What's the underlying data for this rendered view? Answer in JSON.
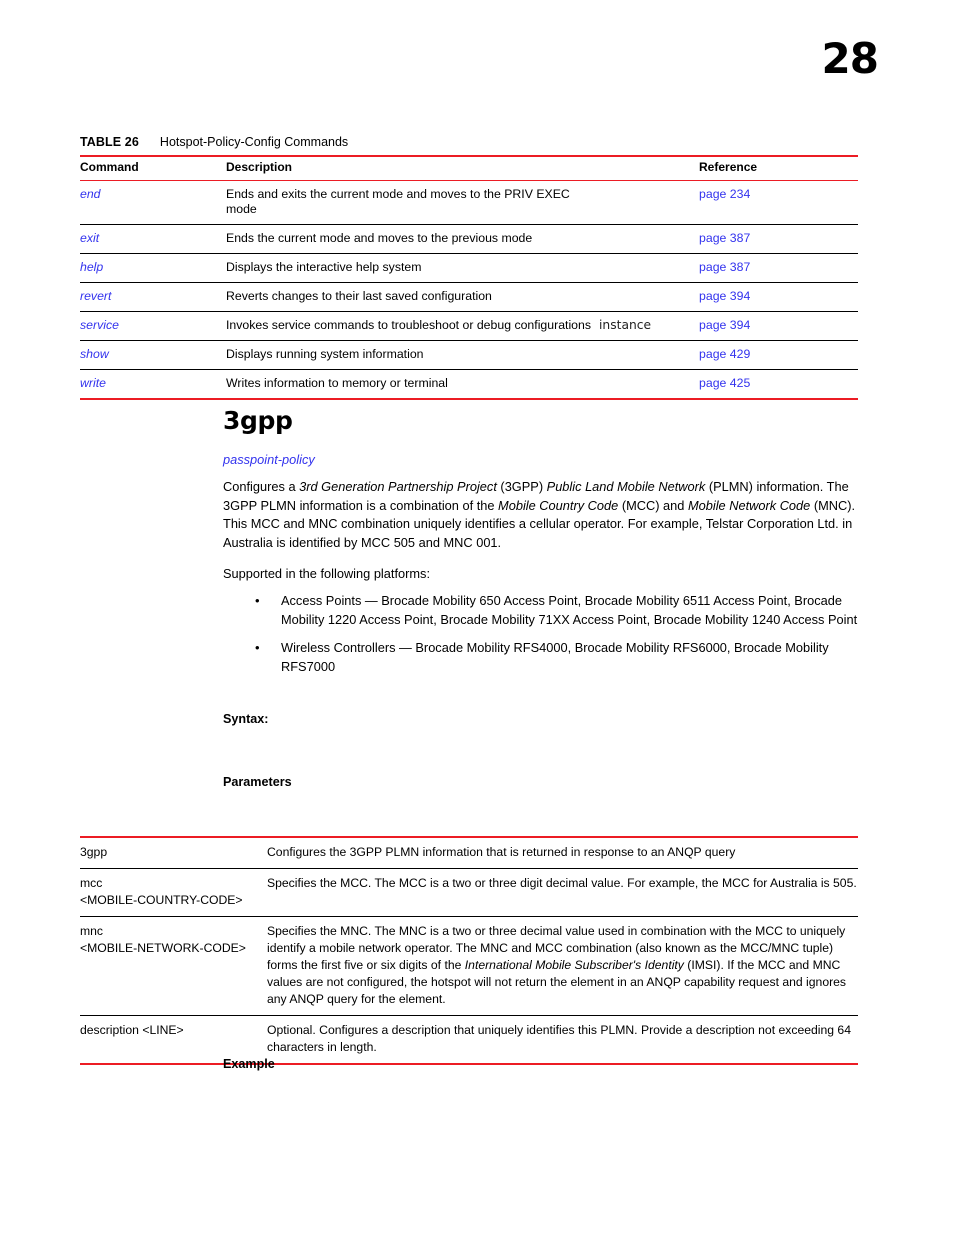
{
  "page": {
    "number": "28"
  },
  "table26": {
    "caption_label": "TABLE 26",
    "caption_text": "Hotspot-Policy-Config Commands",
    "headers": {
      "command": "Command",
      "description": "Description",
      "reference": "Reference"
    },
    "rows": [
      {
        "command": "end",
        "description": "Ends and exits the current mode and moves to the PRIV EXEC mode",
        "extra": "",
        "reference": "page 234"
      },
      {
        "command": "exit",
        "description": "Ends the current mode and moves to the previous mode",
        "extra": "",
        "reference": "page 387"
      },
      {
        "command": "help",
        "description": "Displays the interactive help system",
        "extra": "",
        "reference": "page 387"
      },
      {
        "command": "revert",
        "description": "Reverts changes to their last saved configuration",
        "extra": "",
        "reference": "page 394"
      },
      {
        "command": "service",
        "description": "Invokes service commands to troubleshoot or debug configurations",
        "extra": "instance",
        "reference": "page 394"
      },
      {
        "command": "show",
        "description": "Displays running system information",
        "extra": "",
        "reference": "page 429"
      },
      {
        "command": "write",
        "description": "Writes information to memory or terminal",
        "extra": "",
        "reference": "page 425"
      }
    ]
  },
  "section": {
    "title": "3gpp",
    "mode_link": "passpoint-policy",
    "supported_line": "Supported in the following platforms:",
    "bullets": [
      "Access Points — Brocade Mobility 650 Access Point, Brocade Mobility 6511 Access Point, Brocade Mobility 1220 Access Point, Brocade Mobility 71XX Access Point, Brocade Mobility 1240 Access Point",
      "Wireless Controllers — Brocade Mobility RFS4000, Brocade Mobility RFS6000, Brocade Mobility RFS7000"
    ],
    "bullet_glyph": "•",
    "syntax_head": "Syntax:",
    "parameters_head": "Parameters",
    "example_head": "Example"
  },
  "parameters": {
    "rows": [
      {
        "name_line1": "3gpp",
        "name_line2": "",
        "description": "Configures the 3GPP PLMN information that is returned in response to an ANQP query"
      },
      {
        "name_line1": "mcc",
        "name_line2": "<MOBILE-COUNTRY-CODE>",
        "description": "Specifies the MCC. The MCC is a two or three digit decimal value. For example, the MCC for Australia is 505."
      },
      {
        "name_line1": "mnc",
        "name_line2": "<MOBILE-NETWORK-CODE>",
        "description": "Specifies the MNC. The MNC is a two or three decimal value used in combination with the MCC to uniquely identify a mobile network operator. The MNC and MCC combination (also known as the MCC/MNC tuple) forms the first five or six digits of the International Mobile Subscriber's Identity (IMSI). If the MCC and MNC values are not configured, the hotspot will not return the element in an ANQP capability request and ignores any ANQP query for the element."
      },
      {
        "name_line1": "description <LINE>",
        "name_line2": "",
        "description": "Optional. Configures a description that uniquely identifies this PLMN. Provide a description not exceeding 64 characters in length."
      }
    ]
  },
  "colors": {
    "rule_red": "#EC1C24",
    "link_blue": "#3333EE",
    "text_black": "#000000"
  }
}
